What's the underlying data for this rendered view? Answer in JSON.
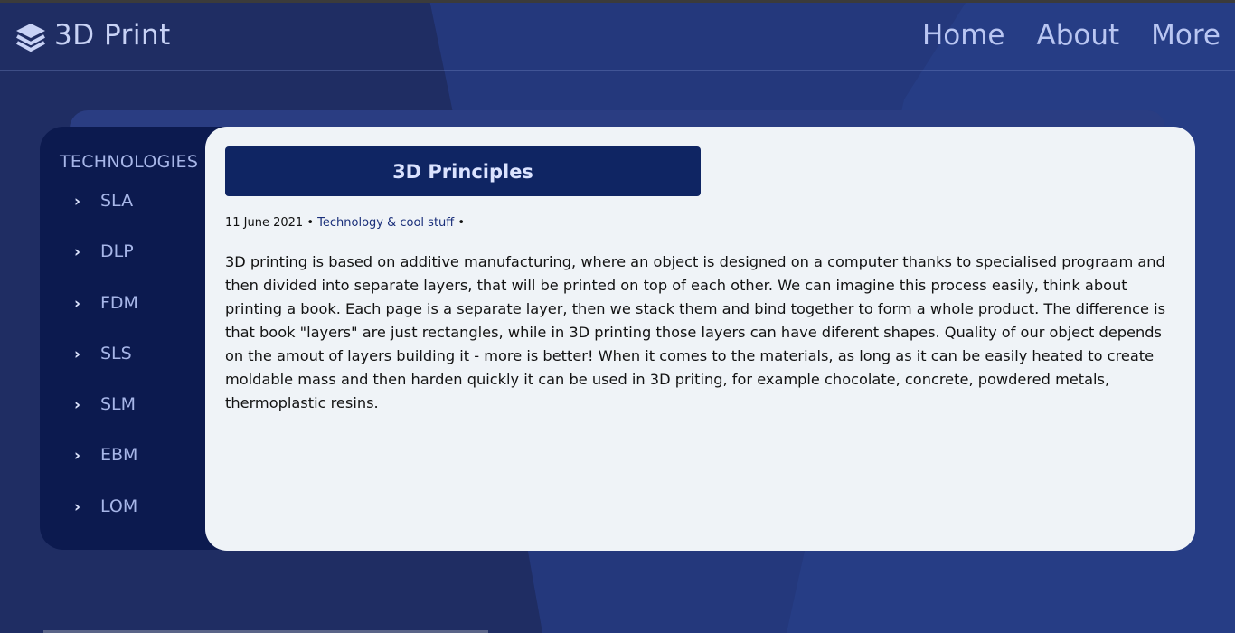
{
  "header": {
    "brand_title": "3D Print",
    "brand_icon": "layers-icon",
    "nav": [
      {
        "label": "Home"
      },
      {
        "label": "About"
      },
      {
        "label": "More"
      }
    ]
  },
  "sidebar": {
    "heading": "TECHNOLOGIES",
    "item_icon": "chevron-right-icon",
    "items": [
      {
        "label": "SLA"
      },
      {
        "label": "DLP"
      },
      {
        "label": "FDM"
      },
      {
        "label": "SLS"
      },
      {
        "label": "SLM"
      },
      {
        "label": "EBM"
      },
      {
        "label": "LOM"
      }
    ]
  },
  "article": {
    "title": "3D Principles",
    "date": "11 June 2021",
    "separator": "•",
    "category": "Technology & cool stuff",
    "body": "3D printing is based on additive manufacturing, where an object is designed on a computer thanks to specialised prograam and then divided into separate layers, that will be printed on top of each other. We can imagine this process easily, think about printing a book. Each page is a separate layer, then we stack them and bind together to form a whole product. The difference is that book \"layers\" are just rectangles, while in 3D printing those layers can have diferent shapes. Quality of our object depends on the amout of layers building it - more is better! When it comes to the materials, as long as it can be easily heated to create moldable mass and then harden quickly it can be used in 3D priting, for example chocolate, concrete, powdered metals, thermoplastic resins."
  },
  "colors": {
    "background": "#21306a",
    "sidebar": "#0c1a4f",
    "title_bar": "#0f2563",
    "content_bg": "#eff3f7",
    "nav_text": "#b9c6f2"
  }
}
